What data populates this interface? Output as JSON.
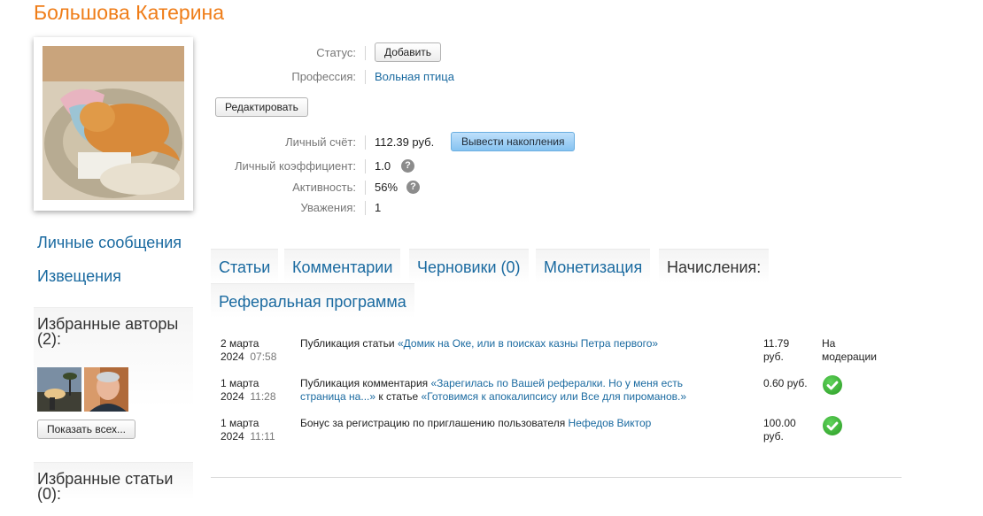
{
  "profile": {
    "name": "Большова Катерина"
  },
  "sidebar": {
    "links": {
      "messages": "Личные сообщения",
      "notifications": "Извещения"
    },
    "favorite_authors": {
      "title": "Избранные авторы (2):",
      "show_all": "Показать всех..."
    },
    "favorite_articles": {
      "title": "Избранные статьи (0):"
    }
  },
  "info": {
    "status": {
      "label": "Статус:",
      "button": "Добавить"
    },
    "profession": {
      "label": "Профессия:",
      "value": "Вольная птица"
    },
    "edit_button": "Редактировать",
    "account": {
      "label": "Личный счёт:",
      "value": "112.39 руб.",
      "button": "Вывести накопления"
    },
    "coefficient": {
      "label": "Личный коэффициент:",
      "value": "1.0"
    },
    "activity": {
      "label": "Активность:",
      "value": "56%"
    },
    "respect": {
      "label": "Уважения:",
      "value": "1"
    },
    "help_glyph": "?"
  },
  "tabs": [
    {
      "label": "Статьи",
      "active": false
    },
    {
      "label": "Комментарии",
      "active": false
    },
    {
      "label": "Черновики (0)",
      "active": false
    },
    {
      "label": "Монетизация",
      "active": false
    },
    {
      "label": "Начисления:",
      "active": true
    },
    {
      "label": "Реферальная программа",
      "active": false
    }
  ],
  "accruals": [
    {
      "date": "2 марта",
      "year": "2024",
      "time": "07:58",
      "description_prefix": "Публикация статьи ",
      "link1": "«Домик на Оке, или в поисках казны Петра первого»",
      "amount_line1": "11.79",
      "amount_line2": "руб.",
      "status_line1": "На",
      "status_line2": "модерации"
    },
    {
      "date": "1 марта",
      "year": "2024",
      "time": "11:28",
      "description_prefix": "Публикация комментария ",
      "link1_line1": "«Зарегилась по Вашей рефералки. Но у меня есть",
      "link1_line2": "страница на...»",
      "middle": " к статье ",
      "link2": "«Готовимся к апокалипсису или Все для пироманов.»",
      "amount": "0.60 руб.",
      "status_icon": "check-circle-icon"
    },
    {
      "date": "1 марта",
      "year": "2024",
      "time": "11:11",
      "description_prefix": "Бонус за регистрацию по приглашению пользователя ",
      "link1": "Нефедов Виктор",
      "amount_line1": "100.00",
      "amount_line2": "руб.",
      "status_icon": "check-circle-icon"
    }
  ],
  "colors": {
    "title": "#ef7d18",
    "link": "#1a6aa0",
    "primary_button": "#86c3f1",
    "check": "#2a9b23"
  }
}
